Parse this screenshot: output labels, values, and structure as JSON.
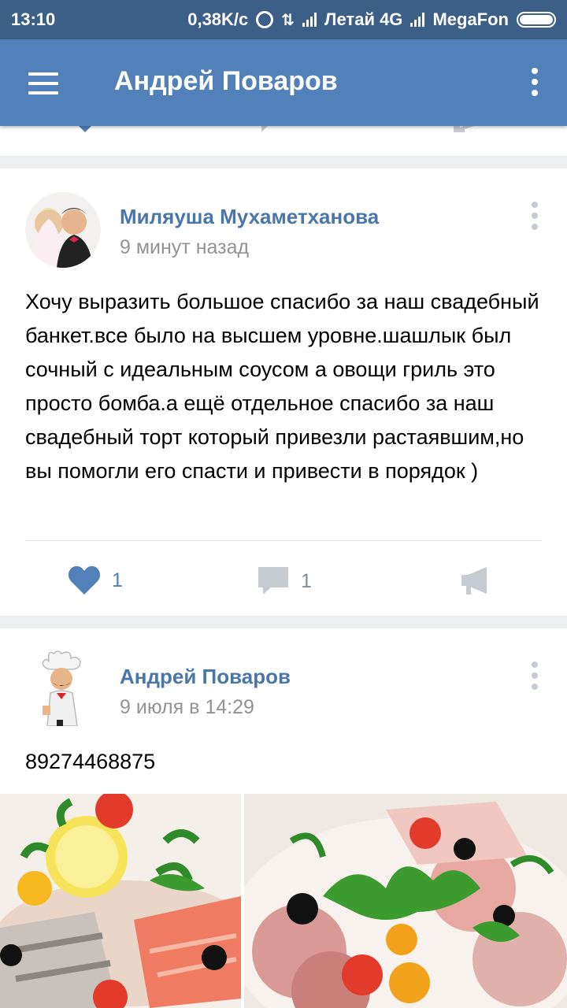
{
  "status_bar": {
    "time": "13:10",
    "speed": "0,38K/с",
    "network_label": "Летай 4G",
    "carrier": "MegaFon"
  },
  "app_bar": {
    "title": "Андрей Поваров",
    "menu_icon": "hamburger-icon",
    "more_icon": "vertical-dots-icon"
  },
  "posts": [
    {
      "author": "Миляуша Мухаметханова",
      "time": "9 минут назад",
      "text": "Хочу выразить большое спасибо за наш свадебный банкет.все было на высшем уровне.шашлык был сочный с идеальным соусом а овощи гриль это просто бомба.а ещё отдельное спасибо за наш свадебный торт который привезли растаявшим,но вы помогли его спасти и привести в порядок )",
      "likes": "1",
      "comments": "1"
    },
    {
      "author": "Андрей Поваров",
      "time": "9 июля в 14:29",
      "text": "89274468875"
    }
  ],
  "colors": {
    "status_bar": "#3b5f87",
    "app_bar": "#5181b8",
    "link": "#4a76a8",
    "muted": "#939393",
    "icon_grey": "#c5cbd1",
    "background": "#edeef0"
  }
}
